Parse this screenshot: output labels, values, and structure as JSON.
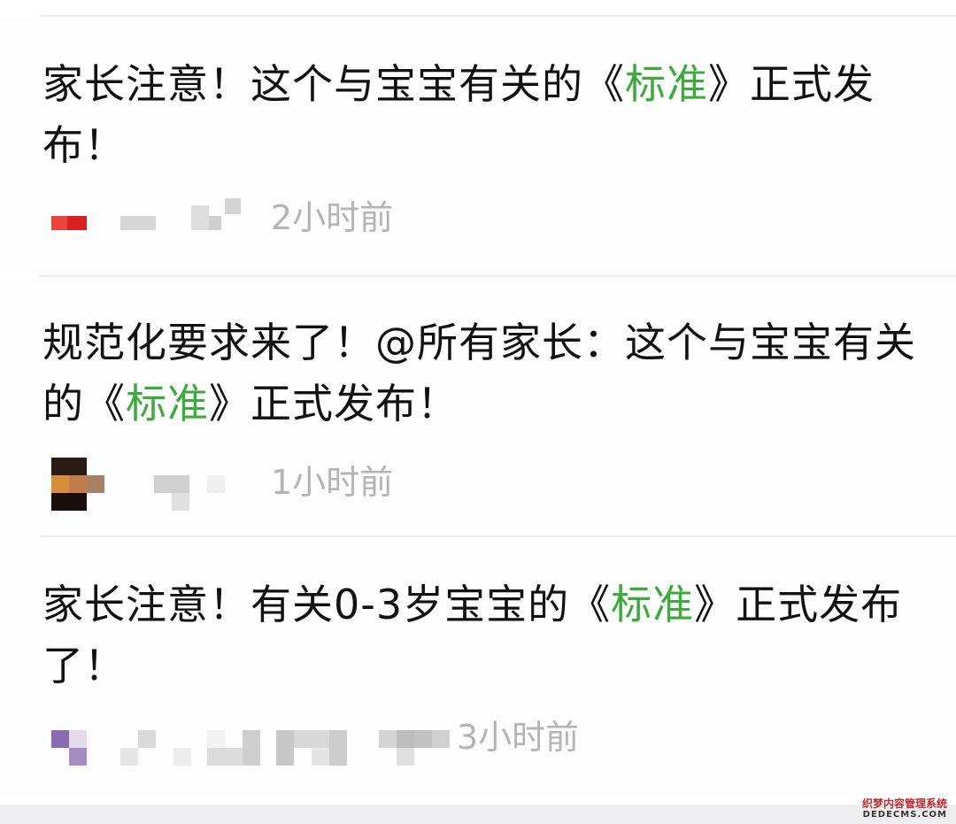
{
  "feed": {
    "items": [
      {
        "title_before": "家长注意！这个与宝宝有关的《",
        "title_highlight": "标准",
        "title_after": "》正式发布！",
        "source_blurred": "",
        "time": "2小时前"
      },
      {
        "title_before": "规范化要求来了！@所有家长：这个与宝宝有关的《",
        "title_highlight": "标准",
        "title_after": "》正式发布！",
        "source_blurred": "",
        "time": "1小时前"
      },
      {
        "title_before": "家长注意！有关0-3岁宝宝的《",
        "title_highlight": "标准",
        "title_after": "》正式发布了！",
        "source_blurred": "",
        "time": "3小时前"
      }
    ]
  },
  "colors": {
    "highlight": "#3cab3c",
    "title_text": "#111111",
    "time_text": "#b4b4b4",
    "divider": "#ececec"
  },
  "watermark": {
    "line1": "织梦内容管理系统",
    "line2": "DEDECMS.COM"
  }
}
